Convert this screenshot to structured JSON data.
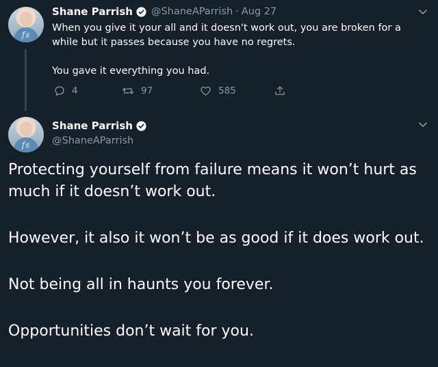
{
  "reply_tweet": {
    "author_name": "Shane Parrish",
    "handle": "@ShaneAParrish",
    "separator": "·",
    "date": "Aug 27",
    "avatar_text": "fs",
    "text_line1": "When you give it your all and it doesn't work out, you are broken for a",
    "text_line2": "while but it passes because you have no regrets.",
    "text_para2": "You gave it everything you had.",
    "replies": "4",
    "retweets": "97",
    "likes": "585"
  },
  "main_tweet": {
    "author_name": "Shane Parrish",
    "handle": "@ShaneAParrish",
    "avatar_text": "fs",
    "paragraphs": [
      "Protecting yourself from failure means it won’t hurt as much if it doesn’t work out.",
      "However, it also it won’t be as good if it does work out.",
      "Not being all in haunts you forever.",
      "Opportunities don’t wait for you."
    ]
  },
  "colors": {
    "background": "#15202b",
    "text_primary": "#ffffff",
    "text_secondary": "#8899a6",
    "verified_badge": "#ffffff",
    "thread_line": "#38444d"
  },
  "icons": {
    "verified": "verified-badge-icon",
    "caret": "chevron-down-icon",
    "reply": "reply-icon",
    "retweet": "retweet-icon",
    "like": "heart-icon",
    "share": "share-icon"
  }
}
